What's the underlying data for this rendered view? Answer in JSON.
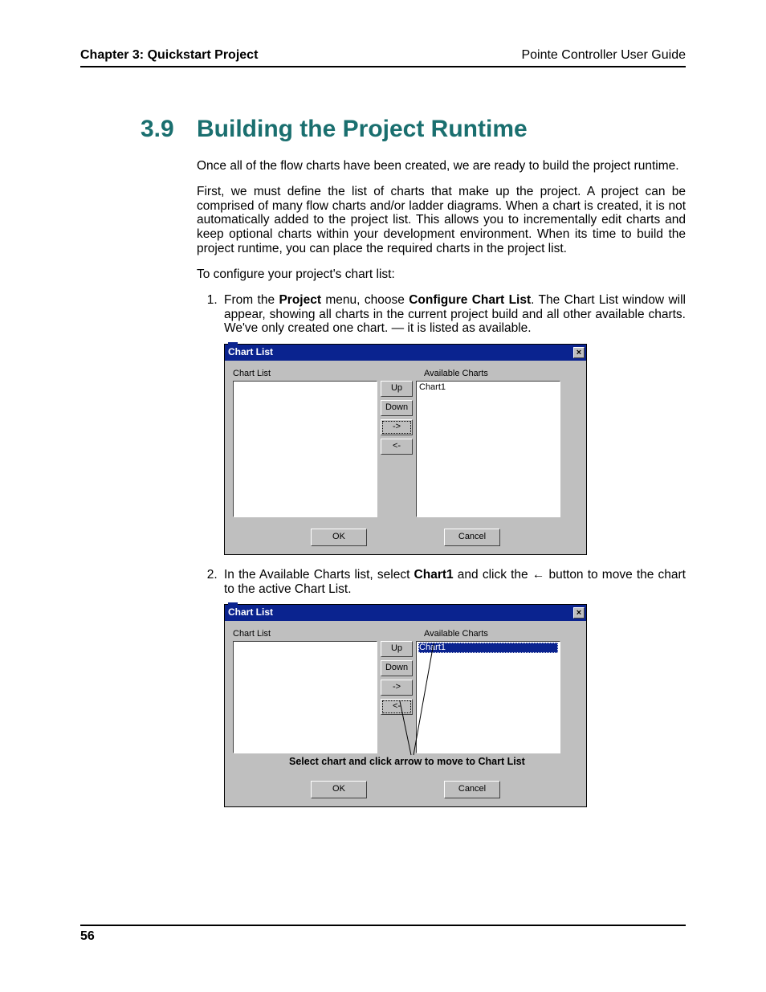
{
  "header": {
    "left": "Chapter 3: Quickstart Project",
    "right": "Pointe Controller User Guide"
  },
  "section": {
    "number": "3.9",
    "title": "Building the Project Runtime"
  },
  "paragraphs": {
    "p1": "Once all of the flow charts have been created, we are ready to build the project runtime.",
    "p2": "First, we must define the list of charts that make up the project. A project can be comprised of many flow charts and/or ladder diagrams. When a chart is created, it is not automatically added to the project list. This allows you to incrementally edit charts and keep optional charts within your development environment. When its time to build the project runtime, you can place the required charts in the project list.",
    "p3": "To configure your project's chart list:"
  },
  "step1": {
    "pre": "From the ",
    "bold1": "Project",
    "mid": " menu, choose ",
    "bold2": "Configure Chart List",
    "post": ". The Chart List window will appear, showing all charts in the current project build and all other available charts. We've only created one chart. — it is listed as available."
  },
  "step2": {
    "pre": "In the Available Charts list, select ",
    "bold1": "Chart1",
    "mid": " and click the ",
    "arrow": "←",
    "post": " button to move the chart to the active Chart List."
  },
  "dialog": {
    "title": "Chart List",
    "label_left": "Chart List",
    "label_right": "Available Charts",
    "btn_up": "Up",
    "btn_down": "Down",
    "btn_right": "->",
    "btn_left": "<-",
    "btn_ok": "OK",
    "btn_cancel": "Cancel",
    "available_item": "Chart1",
    "caption2": "Select chart and click arrow to move to Chart List"
  },
  "footer": {
    "page": "56"
  }
}
